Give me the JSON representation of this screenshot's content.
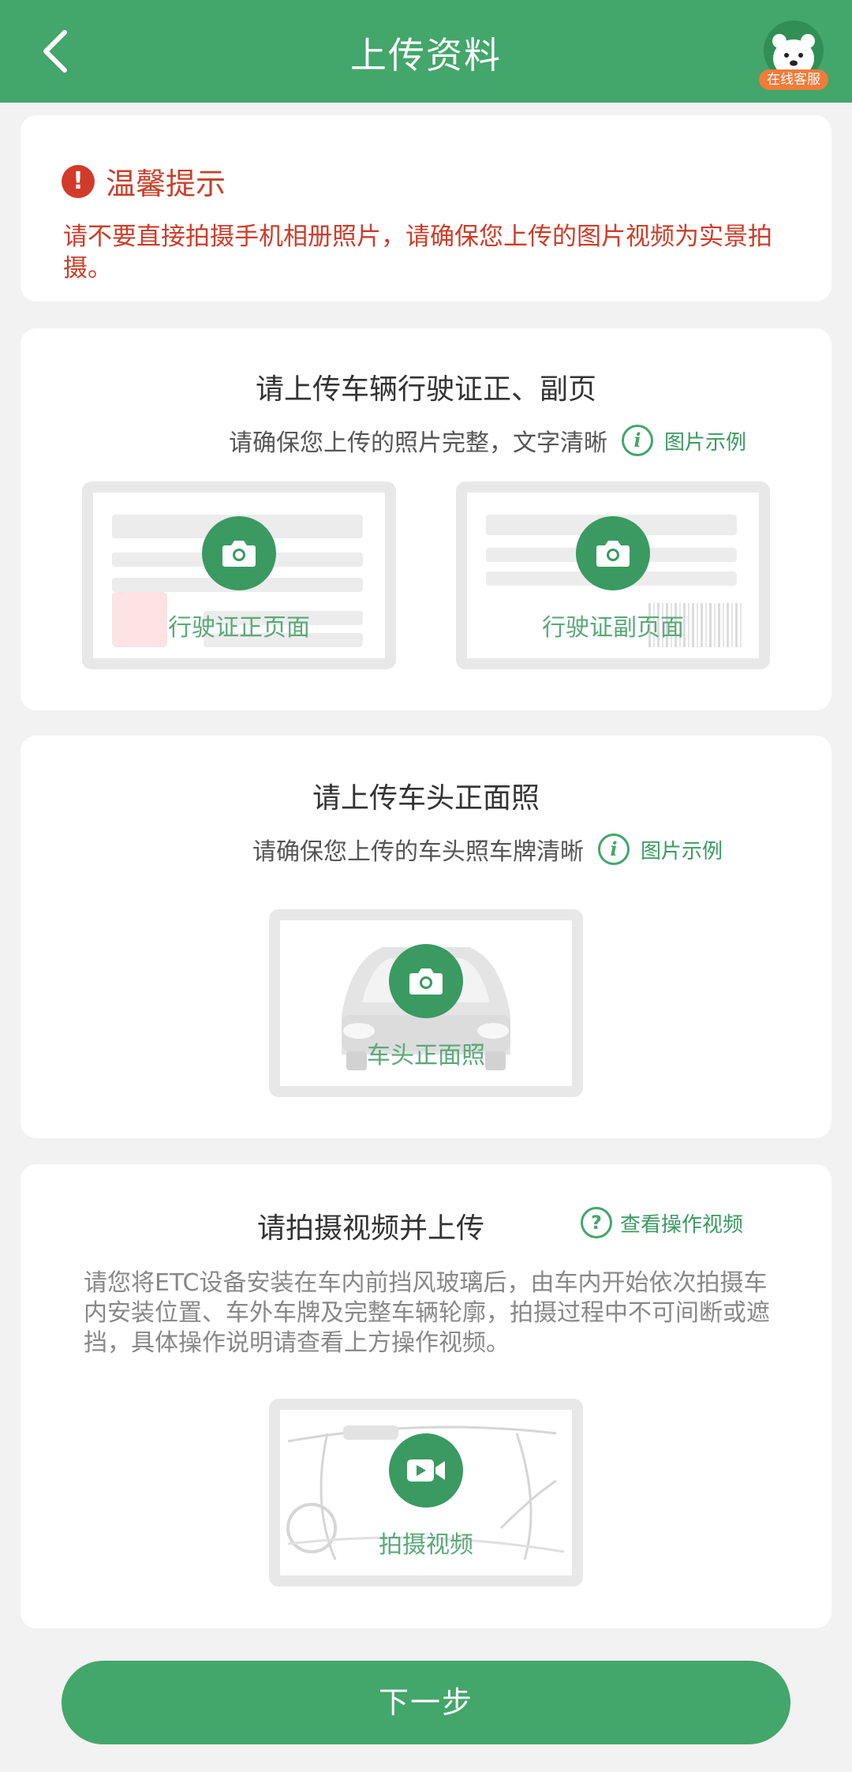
{
  "header": {
    "title": "上传资料",
    "customer_service_label": "在线客服"
  },
  "tip": {
    "title": "温馨提示",
    "body": "请不要直接拍摄手机相册照片，请确保您上传的图片视频为实景拍摄。"
  },
  "license": {
    "title": "请上传车辆行驶证正、副页",
    "subtitle": "请确保您上传的照片完整，文字清晰",
    "example_link": "图片示例",
    "front_label": "行驶证正页面",
    "back_label": "行驶证副页面"
  },
  "car_front": {
    "title": "请上传车头正面照",
    "subtitle": "请确保您上传的车头照车牌清晰",
    "example_link": "图片示例",
    "label": "车头正面照"
  },
  "video": {
    "title": "请拍摄视频并上传",
    "help_link": "查看操作视频",
    "description": "请您将ETC设备安装在车内前挡风玻璃后，由车内开始依次拍摄车内安装位置、车外车牌及完整车辆轮廓，拍摄过程中不可间断或遮挡，具体操作说明请查看上方操作视频。",
    "label": "拍摄视频"
  },
  "footer": {
    "next_label": "下一步"
  },
  "colors": {
    "brand_green": "#43a66a",
    "alert_red": "#c8402c"
  },
  "icons": [
    "back-icon",
    "customer-service-avatar",
    "alert-icon",
    "info-icon",
    "camera-icon",
    "video-camera-icon",
    "question-icon"
  ]
}
